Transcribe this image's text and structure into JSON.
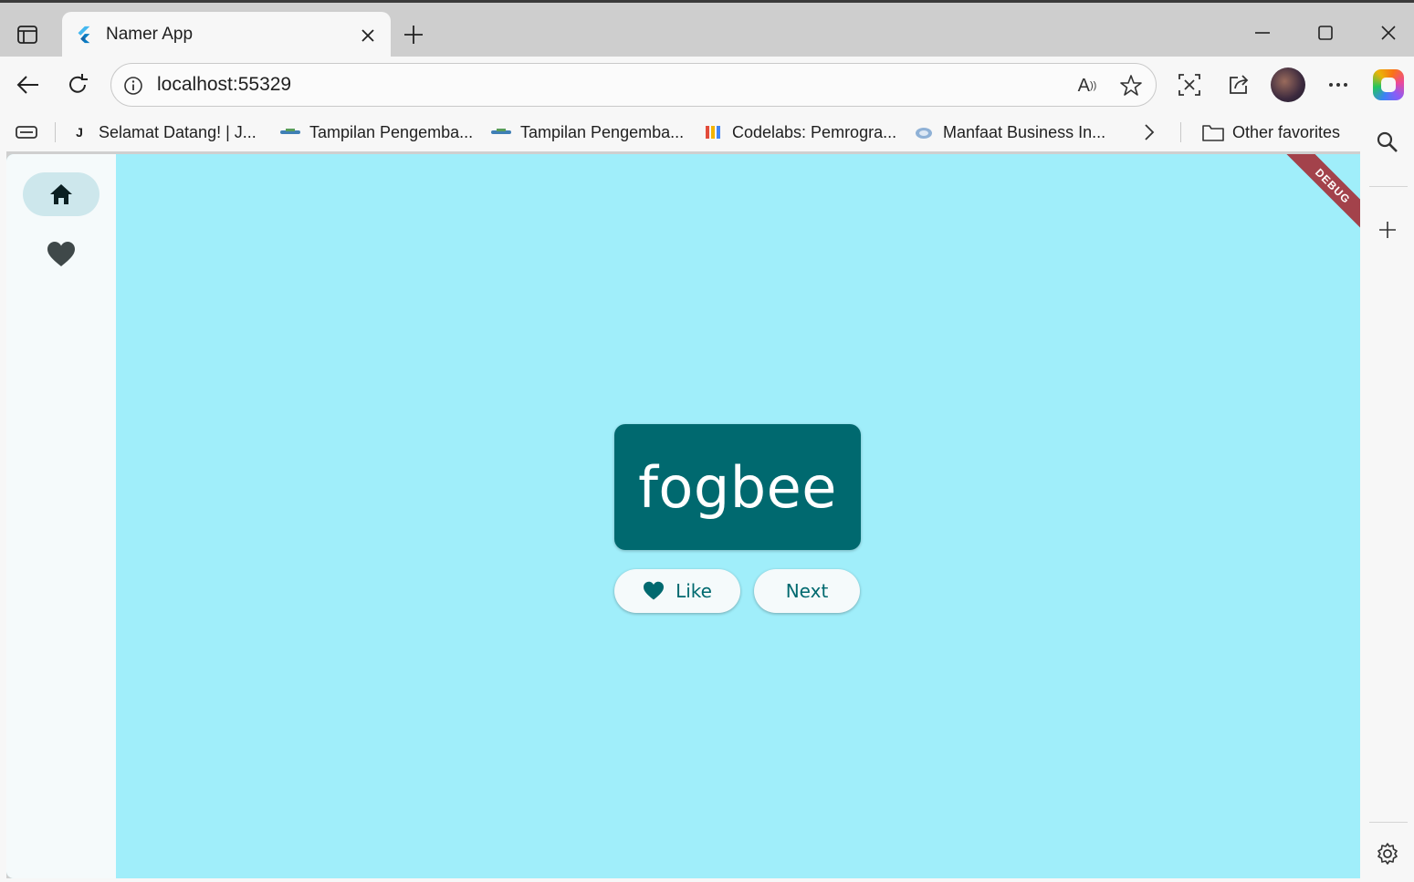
{
  "browser": {
    "tab": {
      "title": "Namer App",
      "favicon": "flutter-logo-icon"
    },
    "address": {
      "url": "localhost:55329"
    },
    "favorites": [
      {
        "label": "Selamat Datang! | J...",
        "icon": "j-favicon-icon"
      },
      {
        "label": "Tampilan Pengemba...",
        "icon": "site-favicon-icon"
      },
      {
        "label": "Tampilan Pengemba...",
        "icon": "site-favicon-icon"
      },
      {
        "label": "Codelabs: Pemrogra...",
        "icon": "codelabs-favicon-icon"
      },
      {
        "label": "Manfaat Business In...",
        "icon": "cloud-favicon-icon"
      }
    ],
    "other_favorites": "Other favorites",
    "colors": {
      "chrome": "#f7f7f7",
      "tabstrip": "#cecece"
    }
  },
  "app": {
    "word": "fogbee",
    "like_label": "Like",
    "next_label": "Next",
    "debug_label": "DEBUG",
    "nav": {
      "selected": "home",
      "items": [
        "home",
        "favorites"
      ]
    },
    "colors": {
      "background": "#a0eefa",
      "primary": "#00696f",
      "rail": "#f5fafb",
      "debug": "#a3424b"
    }
  }
}
